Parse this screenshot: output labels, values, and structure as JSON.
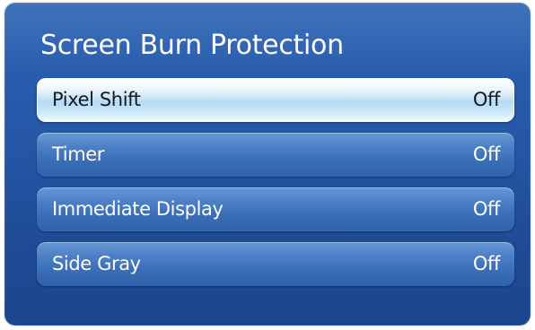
{
  "panel": {
    "title": "Screen Burn Protection"
  },
  "menu": {
    "items": [
      {
        "label": "Pixel Shift",
        "value": "Off",
        "selected": true
      },
      {
        "label": "Timer",
        "value": "Off",
        "selected": false
      },
      {
        "label": "Immediate Display",
        "value": "Off",
        "selected": false
      },
      {
        "label": "Side Gray",
        "value": "Off",
        "selected": false
      }
    ]
  },
  "colors": {
    "panel_background": "#2759aa",
    "item_background": "#4d81c7",
    "selected_background": "#cfeaf9",
    "text_light": "#ffffff",
    "text_dark": "#0d1a2b"
  }
}
